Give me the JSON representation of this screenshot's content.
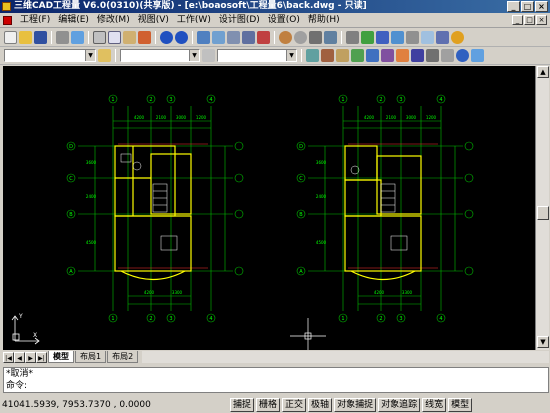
{
  "window": {
    "title": "三维CAD工程量 V6.0(0310)(共享版) - [e:\\boaosoft\\工程量6\\back.dwg - 只读]"
  },
  "menu": [
    "工程(F)",
    "编辑(E)",
    "修改(M)",
    "视图(V)",
    "工作(W)",
    "设计图(D)",
    "设置(O)",
    "帮助(H)"
  ],
  "toolbar": {
    "row1_icons": [
      "new-icon",
      "open-icon",
      "save-icon",
      "print-icon",
      "preview-icon",
      "cut-icon",
      "copy-icon",
      "paste-icon",
      "matchprop-icon",
      "undo-icon",
      "redo-icon",
      "pan-icon",
      "zoom-realtime-icon",
      "zoom-window-icon",
      "zoom-prev-icon",
      "properties-icon",
      "designcenter-icon",
      "help-icon"
    ],
    "colors": {
      "bg": "#d4d0c8",
      "canvas": "#000000"
    }
  },
  "drawings": {
    "left": {
      "top_dims": [
        "4200",
        "2100",
        "3000",
        "1200"
      ],
      "bottom_dims": [
        "4200",
        "3300"
      ],
      "side_dims": [
        "3600",
        "2400",
        "4500"
      ],
      "axis_letters_left": [
        "D",
        "C",
        "B",
        "A"
      ],
      "axis_numbers_top": [
        "1",
        "2",
        "3",
        "4"
      ],
      "axis_numbers_bottom": [
        "1",
        "2",
        "3",
        "4"
      ]
    },
    "right": {
      "top_dims": [
        "4200",
        "2100",
        "3000",
        "1200"
      ],
      "bottom_dims": [
        "4200",
        "3300"
      ],
      "side_dims": [
        "3600",
        "2400",
        "4500"
      ],
      "axis_letters_left": [
        "D",
        "C",
        "B",
        "A"
      ],
      "axis_numbers_top": [
        "1",
        "2",
        "3",
        "4"
      ],
      "axis_numbers_bottom": [
        "1",
        "2",
        "3",
        "4"
      ]
    }
  },
  "ucs": {
    "x": "X",
    "y": "Y"
  },
  "tabs": [
    "模型",
    "布局1",
    "布局2"
  ],
  "command": {
    "line1": "*取消*",
    "line2": "命令:"
  },
  "status": {
    "coords": "41041.5939, 7953.7370 , 0.0000",
    "toggles": [
      "捕捉",
      "栅格",
      "正交",
      "极轴",
      "对象捕捉",
      "对象追踪",
      "线宽",
      "模型"
    ]
  }
}
